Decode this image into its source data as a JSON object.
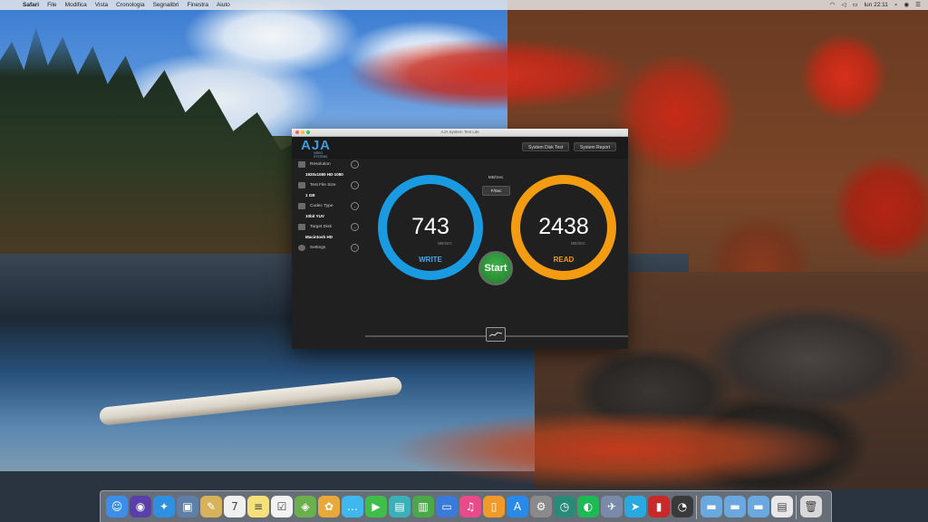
{
  "menubar": {
    "items": [
      "Safari",
      "File",
      "Modifica",
      "Vista",
      "Cronologia",
      "Segnalibri",
      "Finestra",
      "Aiuto"
    ],
    "clock": "lun 22:11"
  },
  "window": {
    "title": "AJA System Test Lite",
    "brand": "AJA",
    "brand_sub": "VIDEO SYSTEMS",
    "buttons": {
      "disk_test": "System Disk Test",
      "report": "System Report"
    }
  },
  "sidebar": {
    "items": [
      {
        "label": "Resolution",
        "value": "1920x1080 HD-1080"
      },
      {
        "label": "Test File Size",
        "value": "1 GB"
      },
      {
        "label": "Codec Type",
        "value": "10bit YUV"
      },
      {
        "label": "Target Disk",
        "value": "Macintosh HD"
      },
      {
        "label": "Settings",
        "value": ""
      }
    ]
  },
  "units": {
    "label": "MB/Sec",
    "selected": "F/Sec"
  },
  "results": {
    "write": {
      "value": "743",
      "unit": "MB/SEC",
      "label": "WRITE",
      "color": "#1a9ae0"
    },
    "read": {
      "value": "2438",
      "unit": "MB/SEC",
      "label": "READ",
      "color": "#f39c12"
    }
  },
  "start_label": "Start",
  "dock": {
    "icons": [
      {
        "name": "finder-icon",
        "glyph": "☺",
        "color": "#3c8ee8"
      },
      {
        "name": "siri-icon",
        "glyph": "◉",
        "color": "#5b3fa8"
      },
      {
        "name": "safari-icon",
        "glyph": "✦",
        "color": "#2f8fe0"
      },
      {
        "name": "preview-icon",
        "glyph": "▣",
        "color": "#5d7fa8"
      },
      {
        "name": "notes-icon",
        "glyph": "✎",
        "color": "#d6b35a"
      },
      {
        "name": "calendar-icon",
        "glyph": "7",
        "color": "#f0f0f0"
      },
      {
        "name": "notes-app-icon",
        "glyph": "≡",
        "color": "#f5e07a"
      },
      {
        "name": "reminders-icon",
        "glyph": "☑",
        "color": "#f2f2f2"
      },
      {
        "name": "maps-icon",
        "glyph": "◈",
        "color": "#6ab04c"
      },
      {
        "name": "photos-icon",
        "glyph": "✿",
        "color": "#e8a93a"
      },
      {
        "name": "messages-icon",
        "glyph": "…",
        "color": "#3fb8f0"
      },
      {
        "name": "facetime-icon",
        "glyph": "▶",
        "color": "#3fbf4a"
      },
      {
        "name": "photo-booth-icon",
        "glyph": "▤",
        "color": "#3ab0b8"
      },
      {
        "name": "numbers-icon",
        "glyph": "▥",
        "color": "#4aa84a"
      },
      {
        "name": "keynote-icon",
        "glyph": "▭",
        "color": "#3a7ad8"
      },
      {
        "name": "itunes-icon",
        "glyph": "♫",
        "color": "#e84a8a"
      },
      {
        "name": "ibooks-icon",
        "glyph": "▯",
        "color": "#f09a2a"
      },
      {
        "name": "app-store-icon",
        "glyph": "A",
        "color": "#2a8ae8"
      },
      {
        "name": "system-preferences-icon",
        "glyph": "⚙",
        "color": "#8a8a8a"
      },
      {
        "name": "time-machine-icon",
        "glyph": "◷",
        "color": "#2a8a7a"
      },
      {
        "name": "spotify-icon",
        "glyph": "◐",
        "color": "#1db954"
      },
      {
        "name": "launchpad-icon",
        "glyph": "✈",
        "color": "#7a8aa8"
      },
      {
        "name": "telegram-icon",
        "glyph": "➤",
        "color": "#2aa8e0"
      },
      {
        "name": "flashcard-icon",
        "glyph": "▮",
        "color": "#c82a2a"
      },
      {
        "name": "aja-system-test-icon",
        "glyph": "◔",
        "color": "#3a3a3a"
      },
      {
        "name": "folder-icon",
        "glyph": "▬",
        "color": "#6aa8e0"
      },
      {
        "name": "downloads-folder-icon",
        "glyph": "▬",
        "color": "#6aa8e0"
      },
      {
        "name": "documents-folder-icon",
        "glyph": "▬",
        "color": "#6aa8e0"
      },
      {
        "name": "document-icon",
        "glyph": "▤",
        "color": "#e8e8e8"
      },
      {
        "name": "trash-icon",
        "glyph": "🗑",
        "color": "#d8d8d8"
      }
    ]
  }
}
